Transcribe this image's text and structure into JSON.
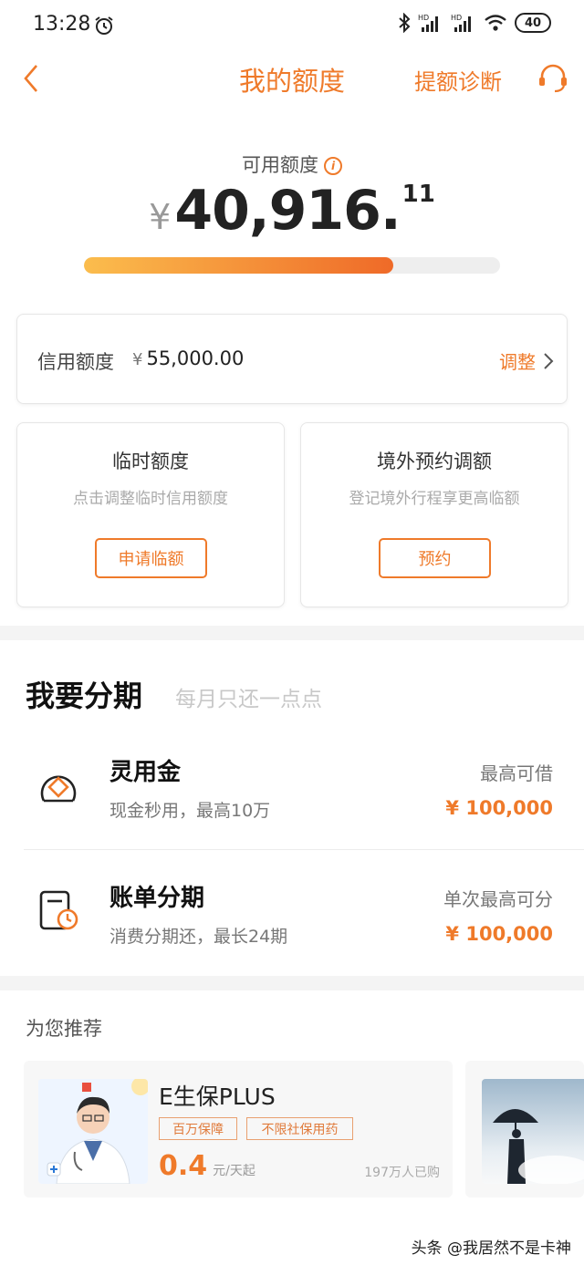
{
  "status_bar": {
    "time": "13:28",
    "battery": "40",
    "icons": [
      "alarm-icon",
      "bluetooth-icon",
      "hd-signal-icon",
      "hd-signal-icon",
      "wifi-icon",
      "battery-icon"
    ]
  },
  "header": {
    "title": "我的额度",
    "diagnosis_link": "提额诊断",
    "icons": [
      "back-icon",
      "customer-service-icon"
    ]
  },
  "available": {
    "label": "可用额度",
    "currency_symbol": "¥",
    "amount_main": "40,916.",
    "amount_decimal": "11",
    "usage_fraction": 0.744
  },
  "credit": {
    "label": "信用额度",
    "currency_symbol": "¥",
    "value": "55,000.00",
    "adjust_label": "调整"
  },
  "temp_limit": {
    "title": "临时额度",
    "subtitle": "点击调整临时信用额度",
    "button": "申请临额"
  },
  "overseas": {
    "title": "境外预约调额",
    "subtitle": "登记境外行程享更高临额",
    "button": "预约"
  },
  "installments": {
    "title": "我要分期",
    "subtitle": "每月只还一点点",
    "items": [
      {
        "name": "灵用金",
        "desc": "现金秒用，最高10万",
        "limit_label": "最高可借",
        "limit": "¥ 100,000",
        "icon": "cash-loan-icon"
      },
      {
        "name": "账单分期",
        "desc": "消费分期还，最长24期",
        "limit_label": "单次最高可分",
        "limit": "¥ 100,000",
        "icon": "bill-installment-icon"
      }
    ]
  },
  "recommend": {
    "title": "为您推荐",
    "card": {
      "name": "E生保PLUS",
      "tags": [
        "百万保障",
        "不限社保用药"
      ],
      "price": "0.4",
      "price_unit": "元/天起",
      "buyers": "197万人已购"
    }
  },
  "watermark": "头条 @我居然不是卡神",
  "colors": {
    "accent": "#ef7a2a",
    "progress_start": "#fbbd4d",
    "progress_end": "#ef6a28",
    "separator": "#f4f4f4"
  }
}
